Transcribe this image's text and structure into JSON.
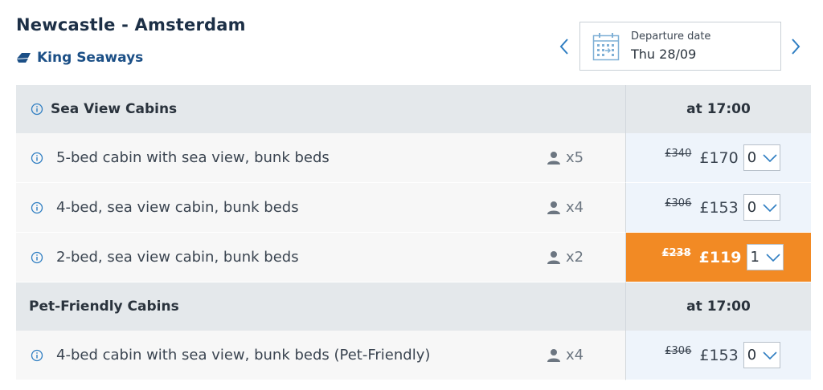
{
  "header": {
    "route": "Newcastle - Amsterdam",
    "operator": "King Seaways"
  },
  "date_picker": {
    "label": "Departure date",
    "value": "Thu 28/09"
  },
  "sections": [
    {
      "title": "Sea View Cabins",
      "time": "at 17:00",
      "has_info": true,
      "cabins": [
        {
          "name": "5-bed cabin with sea view, bunk beds",
          "occupancy": "x5",
          "old_price": "£340",
          "price": "£170",
          "qty": "0",
          "selected": false
        },
        {
          "name": "4-bed, sea view cabin, bunk beds",
          "occupancy": "x4",
          "old_price": "£306",
          "price": "£153",
          "qty": "0",
          "selected": false
        },
        {
          "name": "2-bed, sea view cabin, bunk beds",
          "occupancy": "x2",
          "old_price": "£238",
          "price": "£119",
          "qty": "1",
          "selected": true
        }
      ]
    },
    {
      "title": "Pet-Friendly Cabins",
      "time": "at 17:00",
      "has_info": false,
      "cabins": [
        {
          "name": "4-bed cabin with sea view, bunk beds (Pet-Friendly)",
          "occupancy": "x4",
          "old_price": "£306",
          "price": "£153",
          "qty": "0",
          "selected": false
        }
      ]
    }
  ],
  "colors": {
    "accent_selected": "#f28a24",
    "brand_blue": "#1b4f86",
    "section_bg": "#e4e8eb"
  },
  "icons": {
    "operator": "ship-icon",
    "calendar": "calendar-icon",
    "info": "info-icon",
    "person": "person-icon",
    "chevron": "chevron-down-icon"
  }
}
